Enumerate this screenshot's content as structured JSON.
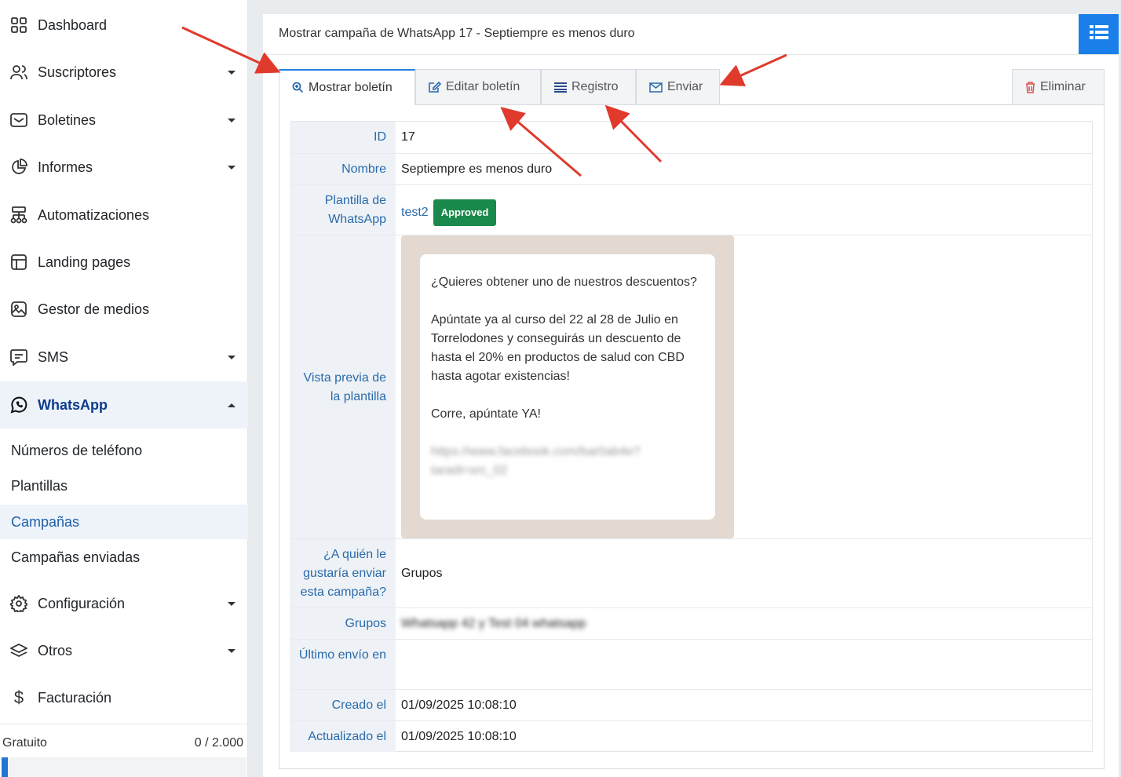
{
  "sidebar": {
    "items": [
      {
        "label": "Dashboard",
        "icon": "dashboard-icon"
      },
      {
        "label": "Suscriptores",
        "icon": "users-icon"
      },
      {
        "label": "Boletines",
        "icon": "mail-icon"
      },
      {
        "label": "Informes",
        "icon": "pie-chart-icon"
      },
      {
        "label": "Automatizaciones",
        "icon": "automation-icon"
      },
      {
        "label": "Landing pages",
        "icon": "layout-icon"
      },
      {
        "label": "Gestor de medios",
        "icon": "image-icon"
      },
      {
        "label": "SMS",
        "icon": "message-icon"
      },
      {
        "label": "WhatsApp",
        "icon": "whatsapp-icon"
      },
      {
        "label": "Configuración",
        "icon": "gear-icon"
      },
      {
        "label": "Otros",
        "icon": "layers-icon"
      },
      {
        "label": "Facturación",
        "icon": "dollar-icon"
      }
    ],
    "whatsapp_sub": [
      {
        "label": "Números de teléfono"
      },
      {
        "label": "Plantillas"
      },
      {
        "label": "Campañas"
      },
      {
        "label": "Campañas enviadas"
      }
    ],
    "plan": {
      "name": "Gratuito",
      "usage": "0 / 2.000",
      "fraction": 0.0
    }
  },
  "header": {
    "title": "Mostrar campaña de WhatsApp 17 - Septiempre es menos duro"
  },
  "tabs": {
    "show": "Mostrar boletín",
    "edit": "Editar boletín",
    "log": "Registro",
    "send": "Enviar",
    "delete": "Eliminar"
  },
  "details": {
    "id_label": "ID",
    "id_value": "17",
    "name_label": "Nombre",
    "name_value": "Septiempre es menos duro",
    "template_label": "Plantilla de WhatsApp",
    "template_value": "test2",
    "template_status": "Approved",
    "preview_label": "Vista previa de la plantilla",
    "preview": {
      "p1": "¿Quieres obtener uno de nuestros descuentos?",
      "p2": "Apúntate ya al curso del 22 al 28 de Julio en Torrelodones y conseguirás un descuento de hasta el 20% en productos de salud con CBD hasta agotar existencias!",
      "p3": "Corre, apúntate YA!",
      "link_blurred": "https://www.facebook.com/bar0ab4e? taradi=src_02"
    },
    "audience_label": "¿A quién le gustaría enviar esta campaña?",
    "audience_value": "Grupos",
    "groups_label": "Grupos",
    "groups_value_blurred": "Whatsapp 42 y Test 04 whatsapp",
    "last_sent_label": "Último envío en",
    "last_sent_value": "",
    "created_label": "Creado el",
    "created_value": "01/09/2025 10:08:10",
    "updated_label": "Actualizado el",
    "updated_value": "01/09/2025 10:08:10"
  },
  "colors": {
    "accent": "#1a7fe8",
    "approved": "#1a8a4c",
    "link": "#2a6aab",
    "annotation_arrow": "#e03a2c"
  }
}
